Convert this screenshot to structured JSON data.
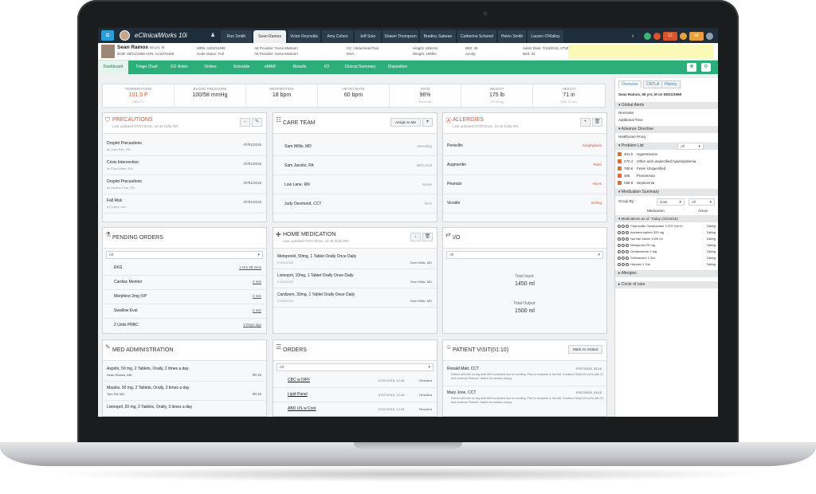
{
  "app": {
    "brand": "eClinicalWorks 10i",
    "menu_icon": "hamburger-icon"
  },
  "patient_tabs": [
    "Ron Smith",
    "Sean Ramos",
    "Victor Reynolds",
    "Amy Cohen",
    "Jeff Soto",
    "Shawn Thompson",
    "Bradley Sabean",
    "Catherine Schonel",
    "Helen Smith",
    "Lauren O'Malley"
  ],
  "topbar_badges": {
    "red": "12",
    "orange": "56"
  },
  "patient": {
    "name": "Sean Ramos",
    "info": "55 yrs, M",
    "dob": "DOB: 08/21/1960  ACN: AC2376428",
    "mrn": "MRN: AZ2014498",
    "code_status": "Code status: Full",
    "att_provider": "Att Provider: Gene Mattram",
    "att_provider2": "Att Provider: Gene Mattram",
    "cc": "CC: Abdominal Pain",
    "cc_value": "MVA",
    "height": "Height: 185cms",
    "weight": "Weight: 180lbs",
    "bmi": "BMI: 45",
    "acuity": "Acuity:",
    "admit_date": "Admit Date: 7/15/2015, 0750",
    "bed": "Bed: 33"
  },
  "nav": [
    "Dashboard",
    "Triage Chart",
    "ED Notes",
    "Orders",
    "Schedule",
    "eMAR",
    "Results",
    "I/O",
    "Clinical Summary",
    "Disposition"
  ],
  "vitals": [
    {
      "label": "TEMPERATURE",
      "value": "101.5 F",
      "sub": "(38.6 C)",
      "alert": true
    },
    {
      "label": "BLOOD PRESSURE",
      "value": "100/58 mmHg",
      "sub": "",
      "alert": false
    },
    {
      "label": "RESPIRATION",
      "value": "18 bpm",
      "sub": "",
      "alert": false
    },
    {
      "label": "HEART RATE",
      "value": "60 bpm",
      "sub": "",
      "alert": false
    },
    {
      "label": "SPO2",
      "value": "96%",
      "sub": "Room Air",
      "alert": false
    },
    {
      "label": "WEIGHT",
      "value": "175 lb",
      "sub": "(79.38 kg)",
      "alert": false
    },
    {
      "label": "HEIGHT",
      "value": "71 in",
      "sub": "(180.34 cm)",
      "alert": false
    }
  ],
  "precautions": {
    "title": "PRECAUTIONS",
    "sub": "Last updated 07/07/2015, 12:45 Dolly RN",
    "items": [
      {
        "name": "Droplet Precautions",
        "by": "by Julie Rile, RN",
        "date": "07/01/2015"
      },
      {
        "name": "Crisis Intervention",
        "by": "by Ellen Miller, RN",
        "date": "07/01/2015"
      },
      {
        "name": "Droplet Precautions",
        "by": "by Martha Pula, RN",
        "date": "07/01/2015"
      },
      {
        "name": "Fall Risk",
        "by": "by Cathy Jom",
        "date": "07/01/2015"
      }
    ]
  },
  "care_team": {
    "title": "CARE TEAM",
    "assign_label": "Assign to Me",
    "members": [
      {
        "name": "Sam Willis, MD",
        "role": "Attending"
      },
      {
        "name": "Sam Jacobs, PA",
        "role": "Mid Level"
      },
      {
        "name": "Lois Lane, RN",
        "role": "Nurse"
      },
      {
        "name": "Judy Desmond, CCT",
        "role": "Tech"
      }
    ]
  },
  "allergies": {
    "title": "ALLERGIES",
    "sub": "Last updated 07/07/2015, 12:45 Dolly RN",
    "items": [
      {
        "name": "Penicillin",
        "reaction": "Anaphylaxis"
      },
      {
        "name": "Augmentin",
        "reaction": "Rash"
      },
      {
        "name": "Peanuts",
        "reaction": "Hives"
      },
      {
        "name": "Vicodin",
        "reaction": "Itching"
      }
    ]
  },
  "pending_orders": {
    "title": "PENDING ORDERS",
    "filter": "All",
    "items": [
      {
        "name": "EKG",
        "time": "1 Hrs 39 mins"
      },
      {
        "name": "Cardiac Monitor",
        "time": "2 min"
      },
      {
        "name": "Morphine 2mg IVP",
        "time": "2 min"
      },
      {
        "name": "Swallow Eval",
        "time": "2 min"
      },
      {
        "name": "2 Units PRBC",
        "time": "2 Days ago"
      }
    ]
  },
  "home_medication": {
    "title": "HOME MEDICATION",
    "sub": "Last updated 07/07/2015, 12:45 Dolly RN",
    "items": [
      {
        "name": "Metoprolol, 50mg, 1 Tablet Orally Once Daily",
        "date": "07/01/2015",
        "by": "Sam Willis, MD"
      },
      {
        "name": "Lisinopril, 10mg, 1 Tablet Orally Once Daily",
        "date": "07/01/2015",
        "by": "Sam Willis, MD"
      },
      {
        "name": "Cardizem, 30mg, 1 Tablet Orally Once Daily",
        "date": "07/01/2015",
        "by": "Sam Willis, MD"
      }
    ]
  },
  "io": {
    "title": "I/O",
    "filter": "All",
    "total_input_label": "Total Input:",
    "total_input": "1450 ml",
    "total_output_label": "Total Output:",
    "total_output": "1500 ml"
  },
  "med_admin": {
    "title": "MED ADMINISTRATION",
    "items": [
      {
        "name": "Aspirin, 50 mg, 2 Tablets, Orally, 2 times a day",
        "by": "Sean Ramos, MD",
        "time": "09:15"
      },
      {
        "name": "Maalox, 50 mg, 2 Tablets, Orally, 2 times a day",
        "by": "Tom Fill, MD",
        "time": "09:15"
      },
      {
        "name": "Lisinopril, 20 mg, 2 Tablets, Orally, 3 times a day",
        "by": "",
        "time": ""
      }
    ]
  },
  "orders": {
    "title": "ORDERS",
    "filter": "All",
    "items": [
      {
        "name": "CBC w DIFF",
        "date": "07/07/2015, 12:45",
        "status": "Resulted"
      },
      {
        "name": "Lipid Panel",
        "date": "07/07/2015, 12:45",
        "status": "Resulted"
      },
      {
        "name": "ABD US w Cont",
        "date": "07/07/2015, 12:45",
        "status": "Resulted"
      }
    ]
  },
  "patient_visit": {
    "title": "PATIENT VISIT(01:10)",
    "mark_label": "Mark As Visited",
    "items": [
      {
        "name": "Ronald Matt, CCT",
        "date": "07/07/2015, 03:15",
        "note": "Patient still with on day shift MRI consulted due to vomiting. Plan to reassess in the AM. Continue NS@125 cc/hr with IV and continue Protonix. Watch for cardiac ectopy."
      },
      {
        "name": "Mary Jone, CCT",
        "date": "07/07/2015, 03:15",
        "note": "Patient still with on day shift MRI consulted due to vomiting. Plan to reassess in the AM. Continue NS@125 cc/hr with IV and continue Protonix. Watch for cardiac ectopy."
      }
    ]
  },
  "sidebar": {
    "tabs": [
      "Overview",
      "CRTLA",
      "History"
    ],
    "patient_line": "Sean Ramos, 55 yrs, M on 08/21/1960",
    "global_alerts": "Global Alerts",
    "reminder": "Reminder",
    "additional_time": "Additional Time",
    "advance_directive": "Advance Directive",
    "healthcare_proxy": "Healthcare Proxy",
    "problem_list": "Problem List",
    "problem_filter": "All",
    "problems": [
      {
        "code": "401.0",
        "name": "Hypertension"
      },
      {
        "code": "272.4",
        "name": "Other and unspecified hyperlipidemia"
      },
      {
        "code": "780.6",
        "name": "Fever Unspecified"
      },
      {
        "code": "486",
        "name": "Pneumonia"
      },
      {
        "code": "038.9",
        "name": "Septicemia"
      }
    ],
    "medication_summary": "Medication Summary",
    "group_by_label": "Group By:",
    "group_by": "Date",
    "med_filter": "All",
    "med_col": "Medication",
    "action_col": "Action",
    "meds_header": "Medications as of: Today (10/15/15)",
    "meds": [
      {
        "name": "Piperacillin-Tazobactam 3.375 Gm IV",
        "action": "Taking"
      },
      {
        "name": "Acetaminophen 325 mg",
        "action": "Taking"
      },
      {
        "name": "Normal Saline 1000 ml",
        "action": "Taking"
      },
      {
        "name": "Metoprolol 25 mg",
        "action": "Taking"
      },
      {
        "name": "Ondansetron 4 mg",
        "action": "Taking"
      },
      {
        "name": "Ceftriaxone 1 Gm",
        "action": "Taking"
      },
      {
        "name": "Heparin 1 Gm",
        "action": "Taking"
      }
    ],
    "allergies": "Allergies",
    "circle_of_care": "Circle of care"
  },
  "colors": {
    "nav": "#2bae7a",
    "topbar": "#1f2d3a",
    "alert": "#d9532c",
    "accent": "#2aa0d8"
  }
}
